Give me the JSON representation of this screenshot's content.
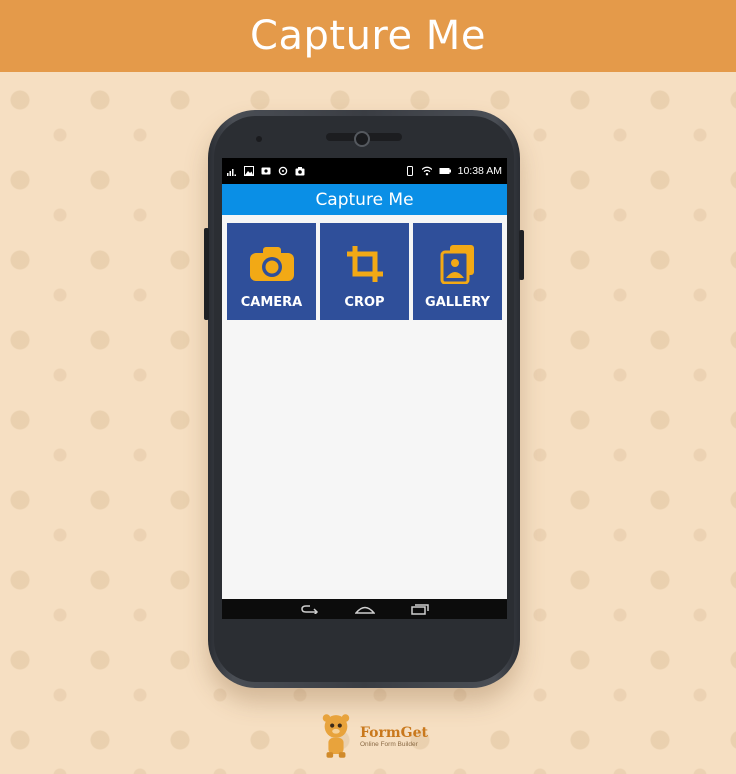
{
  "banner": {
    "title": "Capture Me"
  },
  "status_bar": {
    "time": "10:38",
    "time_suffix": "AM"
  },
  "app": {
    "title": "Capture Me",
    "tiles": [
      {
        "label": "CAMERA",
        "icon": "camera-icon"
      },
      {
        "label": "CROP",
        "icon": "crop-icon"
      },
      {
        "label": "GALLERY",
        "icon": "gallery-icon"
      }
    ]
  },
  "colors": {
    "banner": "#e49a4a",
    "appbar": "#0a8fe6",
    "tile": "#2f4f9a",
    "icon_accent": "#f2a915",
    "background": "#f6dfc2"
  },
  "logo": {
    "name": "FormGet",
    "tagline": "Online Form Builder"
  }
}
